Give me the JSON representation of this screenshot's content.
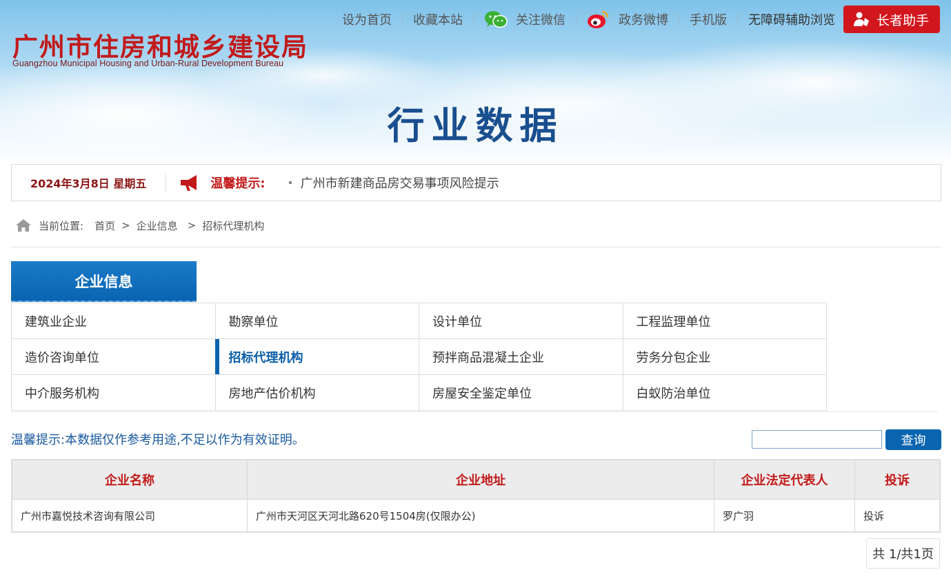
{
  "header": {
    "logo_cn": "广州市住房和城乡建设局",
    "logo_en": "Guangzhou Municipal Housing and Urban-Rural Development Bureau",
    "links": {
      "set_home": "设为首页",
      "bookmark": "收藏本站",
      "wechat": "关注微信",
      "weibo": "政务微博",
      "mobile": "手机版",
      "accessibility": "无障碍辅助浏览"
    },
    "elder_helper": "长者助手"
  },
  "page_title": "行业数据",
  "notice": {
    "date": "2024年3月8日 星期五",
    "label": "温馨提示:",
    "item": "广州市新建商品房交易事项风险提示"
  },
  "breadcrumb": {
    "label": "当前位置:",
    "home": "首页",
    "level1": "企业信息",
    "current": "招标代理机构",
    "sep": ">"
  },
  "category": {
    "title": "企业信息",
    "items": [
      "建筑业企业",
      "勘察单位",
      "设计单位",
      "工程监理单位",
      "造价咨询单位",
      "招标代理机构",
      "预拌商品混凝土企业",
      "劳务分包企业",
      "中介服务机构",
      "房地产估价机构",
      "房屋安全鉴定单位",
      "白蚁防治单位"
    ],
    "active_index": 5
  },
  "tip": "温馨提示:本数据仅作参考用途,不足以作为有效证明。",
  "search": {
    "value": "",
    "button": "查询"
  },
  "table": {
    "headers": [
      "企业名称",
      "企业地址",
      "企业法定代表人",
      "投诉"
    ],
    "rows": [
      [
        "广州市嘉悦技术咨询有限公司",
        "广州市天河区天河北路620号1504房(仅限办公)",
        "罗广羽",
        "投诉"
      ]
    ]
  },
  "pager": "共 1/共1页",
  "colors": {
    "brand_red": "#c21a1a",
    "brand_blue": "#0a64b0",
    "title_blue": "#1a4f8f"
  }
}
